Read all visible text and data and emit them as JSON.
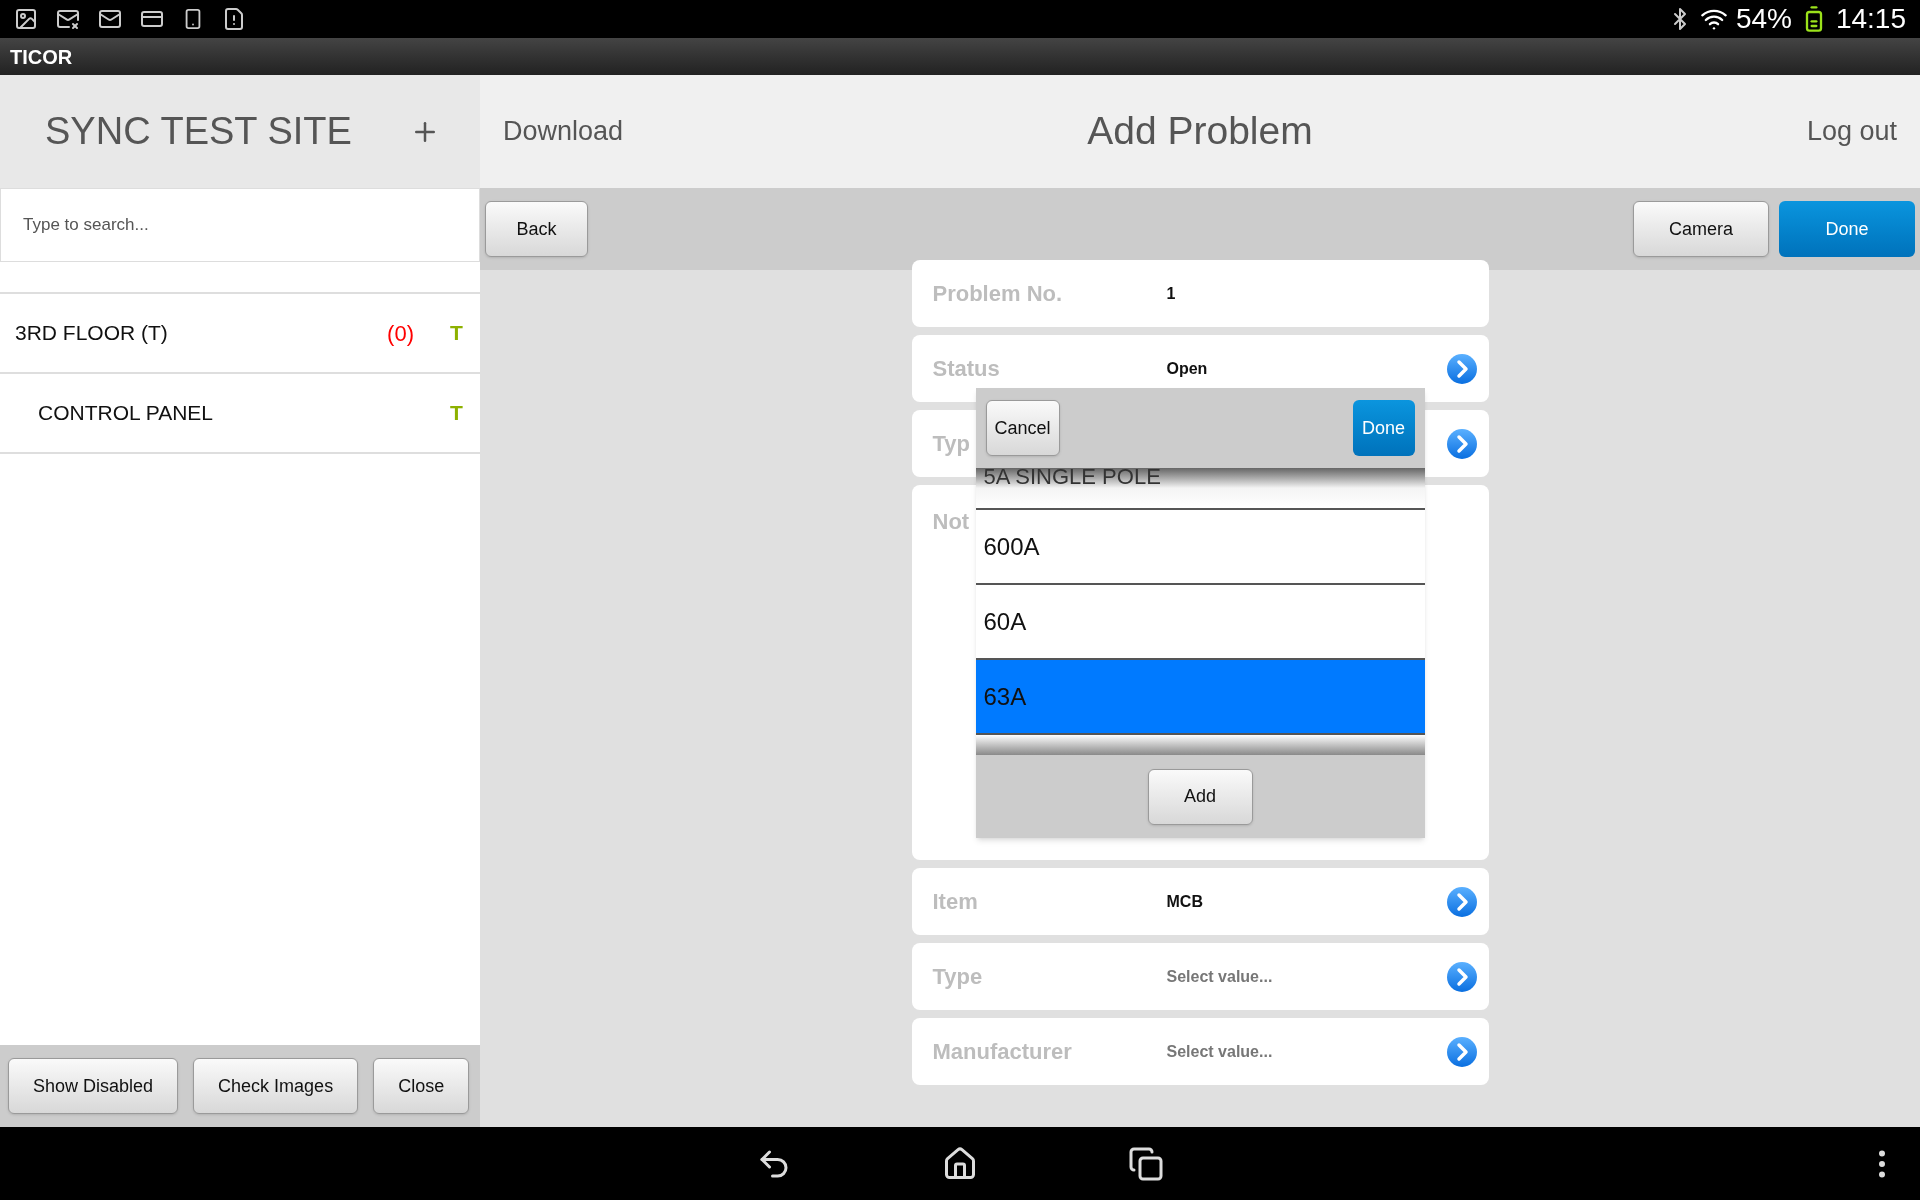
{
  "status_bar": {
    "battery": "54%",
    "time": "14:15"
  },
  "app_bar": {
    "title": "TICOR"
  },
  "sidebar": {
    "title": "SYNC TEST SITE",
    "search": {
      "placeholder": "Type to search..."
    },
    "items": [
      {
        "label": "3RD FLOOR (T)",
        "count": "(0)",
        "badge": "T",
        "children": [
          {
            "label": "CONTROL PANEL",
            "badge": "T"
          }
        ]
      }
    ],
    "buttons": [
      "Show Disabled",
      "Check Images",
      "Close"
    ]
  },
  "header": {
    "left_link": "Download",
    "title": "Add Problem",
    "right_link": "Log out"
  },
  "toolbar": {
    "back": "Back",
    "buttons": [
      {
        "label": "Camera",
        "kind": "default"
      },
      {
        "label": "Done",
        "kind": "primary"
      }
    ]
  },
  "form": {
    "rows": [
      {
        "label": "Problem No.",
        "value": "1",
        "kind": "text"
      },
      {
        "label": "Status",
        "value": "Open",
        "kind": "select"
      },
      {
        "label": "Typ",
        "kind": "select"
      },
      {
        "label": "Not",
        "kind": "notes"
      },
      {
        "label": "Item",
        "value": "MCB",
        "kind": "select"
      },
      {
        "label": "Type",
        "placeholder": "Select value...",
        "kind": "select"
      },
      {
        "label": "Manufacturer",
        "placeholder": "Select value...",
        "kind": "select"
      }
    ]
  },
  "picker": {
    "cancel": "Cancel",
    "done": "Done",
    "options": [
      {
        "label": "5A SINGLE POLE",
        "selected": false,
        "kind": "edge"
      },
      {
        "label": "600A",
        "selected": false,
        "kind": "row"
      },
      {
        "label": "60A",
        "selected": false,
        "kind": "row"
      },
      {
        "label": "63A",
        "selected": true,
        "kind": "row"
      }
    ],
    "add": "Add"
  }
}
